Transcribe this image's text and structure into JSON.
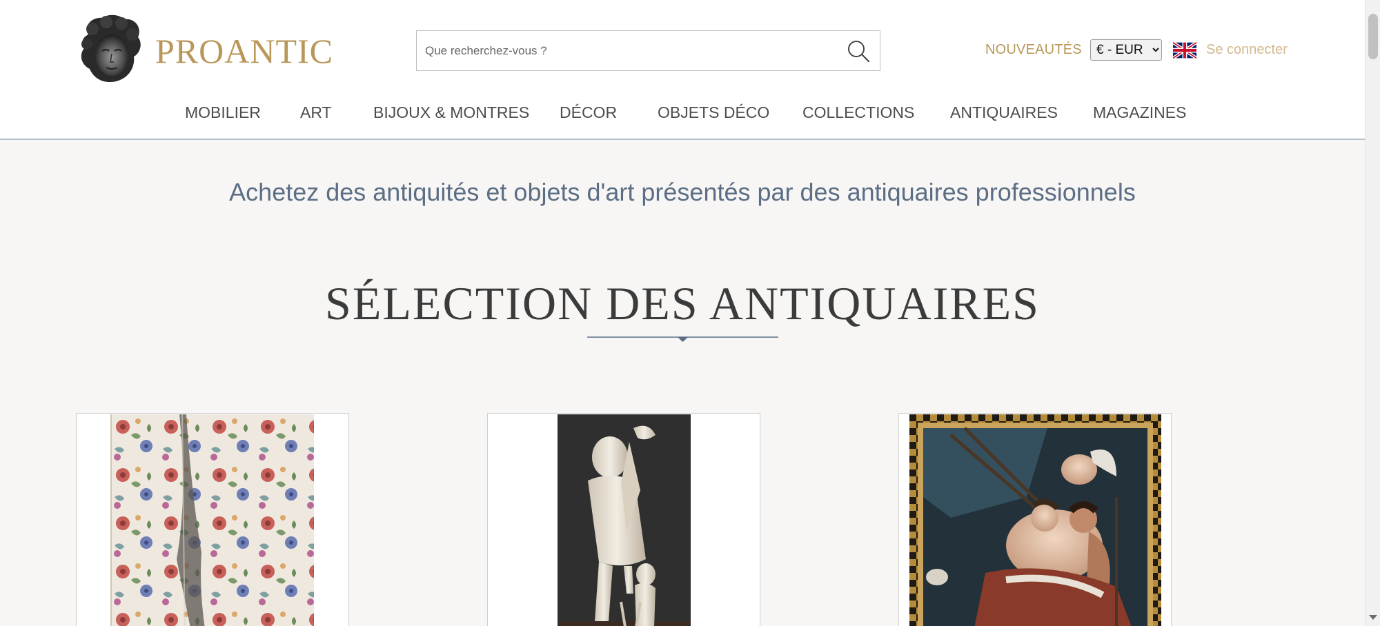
{
  "brand": {
    "name": "PROANTIC",
    "color": "#b99759"
  },
  "search": {
    "placeholder": "Que recherchez-vous ?",
    "icon": "search-icon"
  },
  "header_links": {
    "news": "NOUVEAUTÉS",
    "currency_selected": "€ - EUR",
    "language_icon": "uk-flag-icon",
    "login": "Se connecter"
  },
  "nav": {
    "items": [
      {
        "label": "MOBILIER"
      },
      {
        "label": "ART"
      },
      {
        "label": "BIJOUX & MONTRES"
      },
      {
        "label": "DÉCOR"
      },
      {
        "label": "OBJETS DÉCO"
      },
      {
        "label": "COLLECTIONS"
      },
      {
        "label": "ANTIQUAIRES"
      },
      {
        "label": "MAGAZINES"
      }
    ]
  },
  "main": {
    "tagline": "Achetez des antiquités et objets d'art présentés par des antiquaires professionnels",
    "section_title": "SÉLECTION DES ANTIQUAIRES"
  },
  "cards": [
    {
      "image": "floral-curtain-image"
    },
    {
      "image": "ivory-figure-image"
    },
    {
      "image": "framed-painting-image"
    }
  ],
  "colors": {
    "accent_gold": "#b99759",
    "login_gold": "#d2b98e",
    "tagline_blue": "#5b6e85",
    "divider_blue": "#5b6e85",
    "page_bg": "#f7f6f4"
  }
}
